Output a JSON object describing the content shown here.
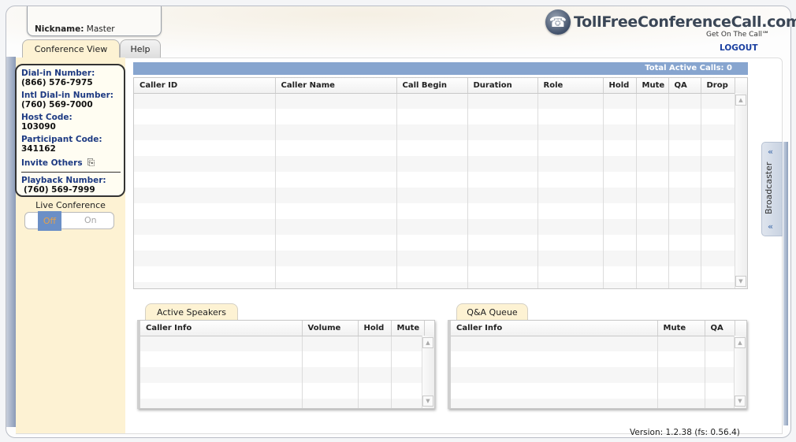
{
  "header": {
    "nickname_label": "Nickname:",
    "nickname_value": "Master",
    "tabs": [
      {
        "label": "Conference View",
        "active": true
      },
      {
        "label": "Help",
        "active": false
      }
    ],
    "logo_text": "TollFreeConferenceCall.com",
    "logo_reg": "®",
    "tagline": "Get On The Call℠",
    "logout": "LOGOUT",
    "logo_icon": "telephone-icon"
  },
  "info_card": {
    "dial_in_label": "Dial-in Number:",
    "dial_in_value": "(866) 576-7975",
    "intl_label": "Intl Dial-in Number:",
    "intl_value": "(760) 569-7000",
    "host_label": "Host Code:",
    "host_value": "103090",
    "participant_label": "Participant Code:",
    "participant_value": "341162",
    "invite_label": "Invite Others",
    "invite_icon": "copy-icon",
    "playback_label": "Playback Number:",
    "playback_value": "(760) 569-7999"
  },
  "live_conference": {
    "label": "Live Conference",
    "off_label": "Off",
    "on_label": "On",
    "state": "Off"
  },
  "main_table": {
    "total_label": "Total Active Calls: 0",
    "columns": [
      "Caller ID",
      "Caller Name",
      "Call Begin",
      "Duration",
      "Role",
      "Hold",
      "Mute",
      "QA",
      "Drop"
    ],
    "rows": []
  },
  "speakers": {
    "tab_label": "Active Speakers",
    "columns": [
      "Caller Info",
      "Volume",
      "Hold",
      "Mute"
    ],
    "rows": []
  },
  "qa_queue": {
    "tab_label": "Q&A Queue",
    "columns": [
      "Caller Info",
      "Mute",
      "QA"
    ],
    "rows": []
  },
  "broadcaster": {
    "label": "Broadcaster",
    "chevron": "«"
  },
  "footer": {
    "version": "Version: 1.2.38 (fs: 0.56.4)"
  },
  "colors": {
    "accent_blue": "#87a5cf",
    "label_navy": "#1d3a82",
    "sidebar_cream": "#fdf2d3",
    "toggle_active": "#6b8fc6",
    "toggle_text": "#e6a24a"
  }
}
